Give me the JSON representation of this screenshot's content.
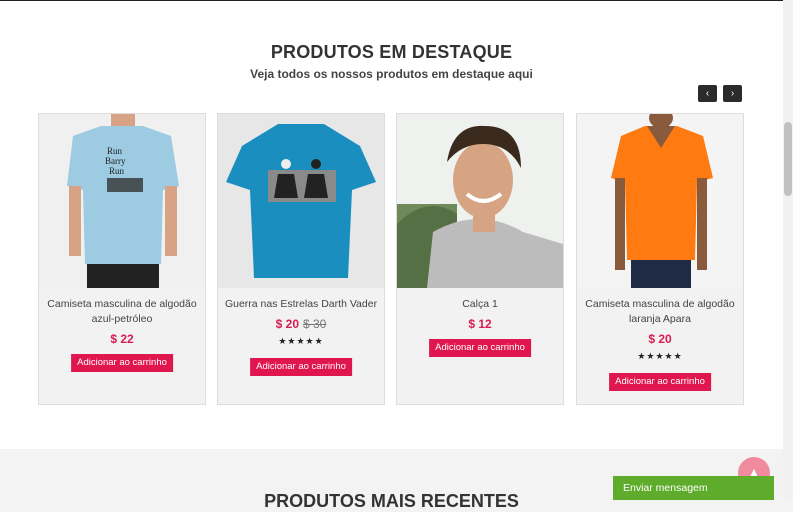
{
  "featured": {
    "title": "PRODUTOS EM DESTAQUE",
    "subtitle": "Veja todos os nossos produtos em destaque aqui",
    "prev_icon": "‹",
    "next_icon": "›",
    "products": [
      {
        "name": "Camiseta masculina de algodão azul-petróleo",
        "price": "$ 22",
        "old_price": "",
        "rating": "",
        "add_label": "Adicionar ao carrinho"
      },
      {
        "name": "Guerra nas Estrelas Darth Vader",
        "price": "$ 20",
        "old_price": "$ 30",
        "rating": "★★★★★",
        "add_label": "Adicionar ao carrinho"
      },
      {
        "name": "Calça 1",
        "price": "$ 12",
        "old_price": "",
        "rating": "",
        "add_label": "Adicionar ao carrinho"
      },
      {
        "name": "Camiseta masculina de algodão laranja Apara",
        "price": "$ 20",
        "old_price": "",
        "rating": "★★★★★",
        "add_label": "Adicionar ao carrinho"
      }
    ]
  },
  "latest": {
    "title": "PRODUTOS MAIS RECENTES"
  },
  "chat": {
    "label": "Enviar mensagem"
  },
  "icons": {
    "prev": "chevron-left-icon",
    "next": "chevron-right-icon",
    "back_to_top": "arrow-up-icon"
  },
  "colors": {
    "accent": "#e0164f",
    "chat": "#5fac2c",
    "to_top": "#f08a9d"
  }
}
